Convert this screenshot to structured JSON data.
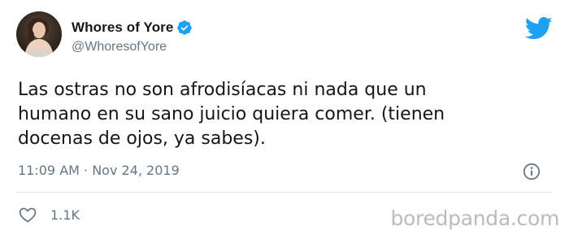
{
  "tweet": {
    "display_name": "Whores of Yore",
    "handle": "@WhoresofYore",
    "verified_icon": "verified-badge-icon",
    "avatar": "portrait-avatar",
    "text_lines": [
      "Las ostras no son afrodisíacas ni nada que un",
      "humano en su sano juicio quiera comer. (tienen",
      "docenas de ojos, ya sabes)."
    ],
    "timestamp": "11:09 AM · Nov 24, 2019",
    "likes": "1.1K",
    "like_icon": "heart-icon",
    "info_icon": "info-icon",
    "platform_icon": "twitter-bird-icon"
  },
  "watermark": "boredpanda.com",
  "colors": {
    "brand_blue": "#1da1f2",
    "secondary_text": "#657786",
    "primary_text": "#14171a",
    "divider": "#e1e8ed"
  }
}
